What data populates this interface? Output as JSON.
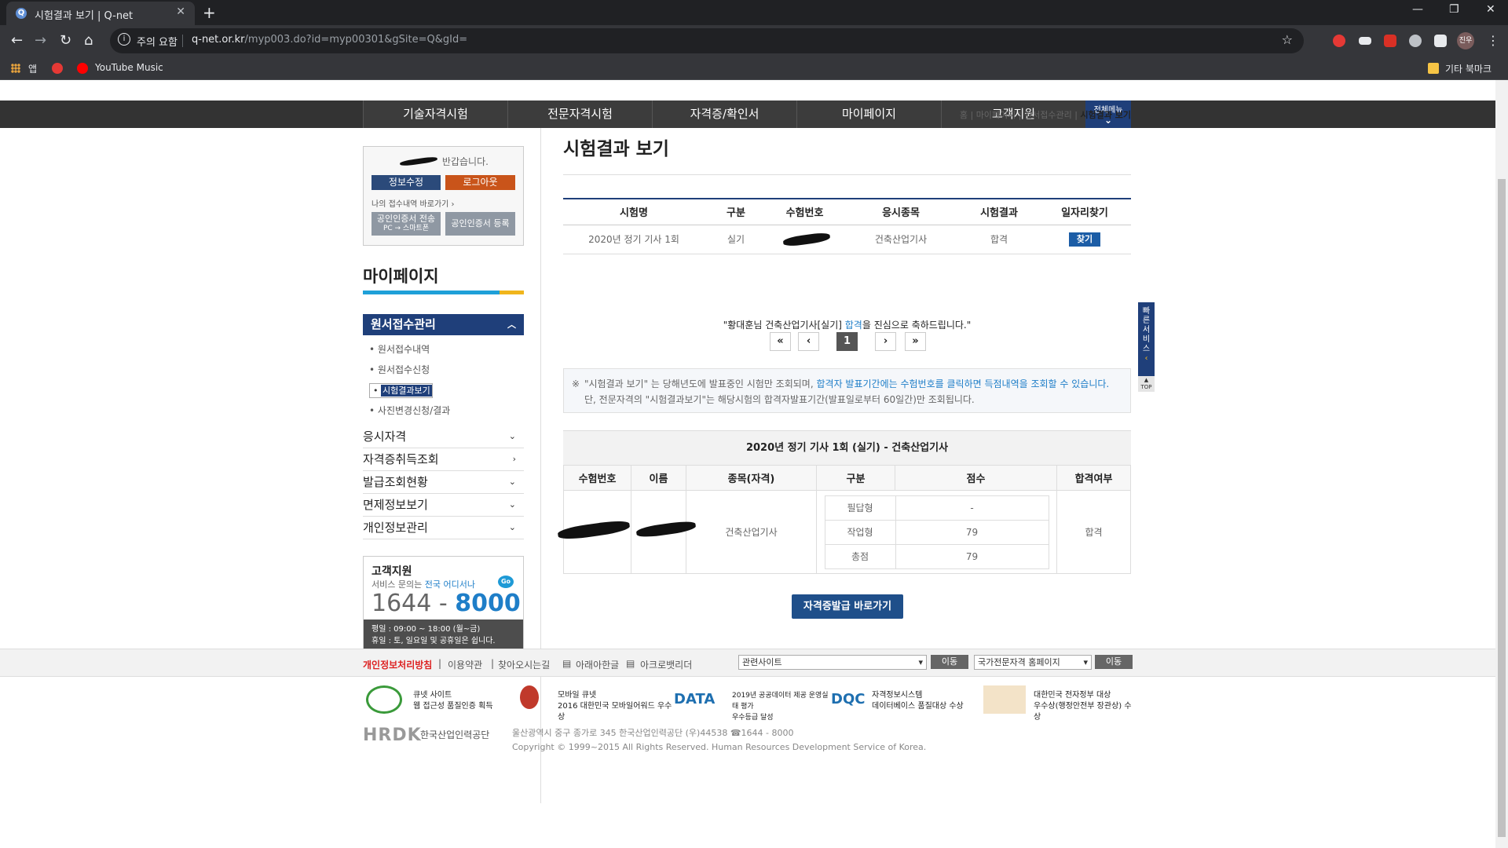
{
  "browser": {
    "tab_title": "시험결과 보기 | Q-net",
    "security_label": "주의 요함",
    "url_host": "q-net.or.kr",
    "url_path": "/myp003.do?id=myp00301&gSite=Q&gId=",
    "profile_label": "진우",
    "bookmarks": [
      {
        "label": "앱"
      },
      {
        "label": "YouTube Music"
      }
    ],
    "other_bookmarks": "기타 북마크"
  },
  "gnb": {
    "items": [
      "기술자격시험",
      "전문자격시험",
      "자격증/확인서",
      "마이페이지",
      "고객지원"
    ],
    "all_menu": "전체메뉴"
  },
  "login": {
    "welcome": "반갑습니다.",
    "edit_info": "정보수정",
    "logout": "로그아웃",
    "shortcut": "나의 접수내역 바로가기",
    "cert_transfer": "공인인증서 전송",
    "cert_transfer_sub": "PC → 스마트폰",
    "cert_register": "공인인증서 등록"
  },
  "sidebar": {
    "title": "마이페이지",
    "active_section": "원서접수관리",
    "sub_items": [
      "원서접수내역",
      "원서접수신청",
      "시험결과보기",
      "사진변경신청/결과"
    ],
    "menus": [
      "응시자격",
      "자격증취득조회",
      "발급조회현황",
      "면제정보보기",
      "개인정보관리"
    ]
  },
  "customer_service": {
    "title": "고객지원",
    "desc_prefix": "서비스 문의는 ",
    "desc_highlight": "전국 어디서나",
    "go": "Go",
    "num_prefix": "1644 - ",
    "num_main": "8000",
    "hours_weekday": "평일 : 09:00 ~ 18:00 (월~금)",
    "hours_holiday": "휴일 : 토, 일요일 및 공휴일은 쉽니다."
  },
  "breadcrumb": [
    "홈",
    "마이페이지",
    "원서접수관리",
    "시험결과 보기"
  ],
  "page_title": "시험결과 보기",
  "results": {
    "headers": [
      "시험명",
      "구분",
      "수험번호",
      "응시종목",
      "시험결과",
      "일자리찾기"
    ],
    "row": {
      "exam": "2020년 정기 기사 1회",
      "type": "실기",
      "number": "",
      "subject": "건축산업기사",
      "result": "합격",
      "find": "찾기"
    }
  },
  "congrats": {
    "before": "\"황대훈님 건축산업기사[실기] ",
    "pass": "합격",
    "after": "을 진심으로 축하드립니다.\""
  },
  "pagination": {
    "first": "«",
    "prev": "‹",
    "current": "1",
    "next": "›",
    "last": "»"
  },
  "notice": {
    "mark": "※",
    "part1": "\"시험결과 보기\" 는 당해년도에 발표중인 시험만 조회되며, ",
    "part2_blue": "합격자 발표기간에는 수험번호를 클릭하면 득점내역을 조회할 수 있습니다.",
    "part3": " 단, 전문자격의 \"시험결과보기\"는 해당시험의 합격자발표기간(발표일로부터 60일간)만 조회됩니다."
  },
  "detail": {
    "title": "2020년 정기 기사 1회 (실기) - 건축산업기사",
    "headers": [
      "수험번호",
      "이름",
      "종목(자격)",
      "구분",
      "점수",
      "합격여부"
    ],
    "subject": "건축산업기사",
    "scores": [
      {
        "label": "필답형",
        "score": "-"
      },
      {
        "label": "작업형",
        "score": "79"
      },
      {
        "label": "총점",
        "score": "79"
      }
    ],
    "result": "합격"
  },
  "cert_button": "자격증발급 바로가기",
  "quick_service": {
    "label": "빠른서비스",
    "top": "TOP"
  },
  "footer": {
    "privacy": "개인정보처리방침",
    "terms": "이용약관",
    "directions": "찾아오시는길",
    "hwp": "아래아한글",
    "acrobat": "아크로뱃리더",
    "select1": "관련사이트",
    "select2": "국가전문자격 홈페이지",
    "go": "이동",
    "awards": [
      {
        "line1": "큐넷 사이트",
        "line2": "웹 접근성 품질인증 획득"
      },
      {
        "line1": "모바일 큐넷",
        "line2": "2016 대한민국 모바일어워드 우수상"
      },
      {
        "line1": "2019년 공공데이터 제공 운영실태 평가",
        "line2": "우수등급 달성"
      },
      {
        "line1": "자격정보시스템",
        "line2": "데이터베이스 품질대상 수상"
      },
      {
        "line1": "대한민국 전자정부 대상",
        "line2": "우수상(행정안전부 장관상) 수상"
      }
    ],
    "org_name": "한국산업인력공단",
    "address": "울산광역시 중구 종가로 345 한국산업인력공단 (우)44538 ☎1644 - 8000",
    "copyright": "Copyright © 1999~2015 All Rights Reserved. Human Resources Development Service of Korea."
  }
}
